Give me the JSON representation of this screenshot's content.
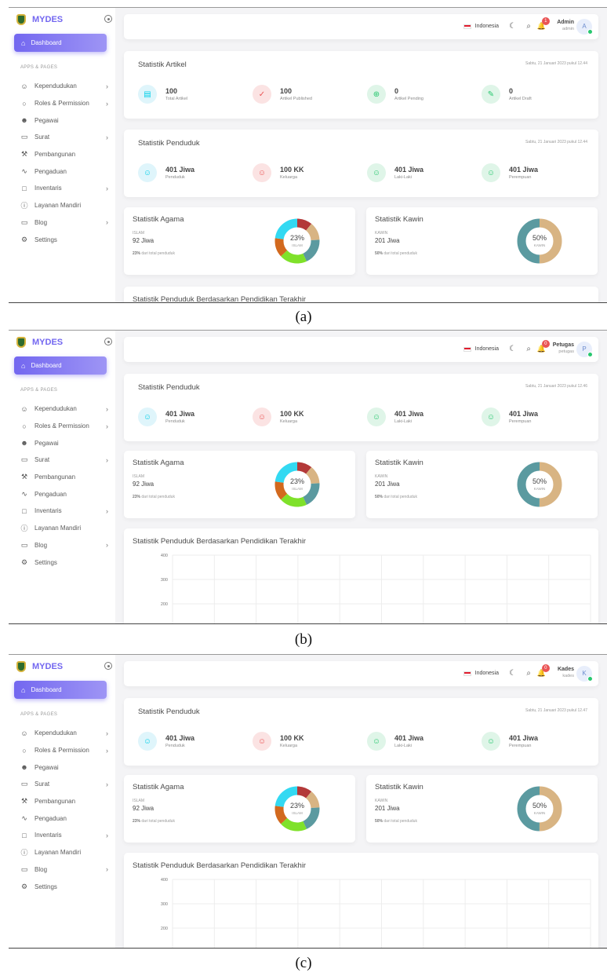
{
  "brand": {
    "name": "MYDES"
  },
  "sidebar": {
    "dashboard_label": "Dashboard",
    "section": "APPS & PAGES",
    "items": [
      {
        "label": "Kependudukan",
        "icon": "users-icon",
        "chevron": true
      },
      {
        "label": "Roles & Permission",
        "icon": "shield-icon",
        "chevron": true
      },
      {
        "label": "Pegawai",
        "icon": "user-check-icon",
        "chevron": false
      },
      {
        "label": "Surat",
        "icon": "inbox-icon",
        "chevron": true
      },
      {
        "label": "Pembangunan",
        "icon": "tool-icon",
        "chevron": false
      },
      {
        "label": "Pengaduan",
        "icon": "activity-icon",
        "chevron": false
      },
      {
        "label": "Inventaris",
        "icon": "tablet-icon",
        "chevron": true
      },
      {
        "label": "Layanan Mandiri",
        "icon": "info-icon",
        "chevron": false
      },
      {
        "label": "Blog",
        "icon": "monitor-icon",
        "chevron": true
      },
      {
        "label": "Settings",
        "icon": "settings-icon",
        "chevron": false
      }
    ]
  },
  "topbar": {
    "language": "Indonesia"
  },
  "captions": [
    "(a)",
    "(b)",
    "(c)"
  ],
  "panels": [
    {
      "user": {
        "name": "Admin",
        "role": "admin",
        "initial": "A",
        "notifications": "1"
      },
      "artikel": {
        "title": "Statistik Artikel",
        "date": "Sabtu, 21 Januari 2023 pukul 12.44",
        "stats": [
          {
            "value": "100",
            "label": "Total Artikel",
            "icon": "file-icon"
          },
          {
            "value": "100",
            "label": "Artikel Published",
            "icon": "check-icon"
          },
          {
            "value": "0",
            "label": "Artikel Pending",
            "icon": "plus-circle-icon"
          },
          {
            "value": "0",
            "label": "Artikel Draft",
            "icon": "edit-icon"
          }
        ]
      },
      "penduduk": {
        "title": "Statistik Penduduk",
        "date": "Sabtu, 21 Januari 2023 pukul 12.44"
      }
    },
    {
      "user": {
        "name": "Petugas",
        "role": "petugas",
        "initial": "P",
        "notifications": "0"
      },
      "penduduk": {
        "title": "Statistik Penduduk",
        "date": "Sabtu, 21 Januari 2023 pukul 12.46"
      }
    },
    {
      "user": {
        "name": "Kades",
        "role": "kades",
        "initial": "K",
        "notifications": "0"
      },
      "penduduk": {
        "title": "Statistik Penduduk",
        "date": "Sabtu, 21 Januari 2023 pukul 12.47"
      }
    }
  ],
  "penduduk_stats": [
    {
      "value": "401 Jiwa",
      "label": "Penduduk",
      "icon": "user-icon",
      "tone": "info"
    },
    {
      "value": "100 KK",
      "label": "Keluarga",
      "icon": "users-icon",
      "tone": "red"
    },
    {
      "value": "401 Jiwa",
      "label": "Laki-Laki",
      "icon": "user-icon",
      "tone": "green"
    },
    {
      "value": "401 Jiwa",
      "label": "Perempuan",
      "icon": "user-icon",
      "tone": "green"
    }
  ],
  "agama": {
    "title": "Statistik Agama",
    "label": "ISLAM",
    "value": "92 Jiwa",
    "pct_bold": "23%",
    "pct_text": "dari total penduduk",
    "center": "23%",
    "center_sub": "ISLAM",
    "segments": [
      {
        "share": 0.11,
        "color": "#b33939"
      },
      {
        "share": 0.13,
        "color": "#d8b483"
      },
      {
        "share": 0.19,
        "color": "#5b9aa0"
      },
      {
        "share": 0.2,
        "color": "#7fe12a"
      },
      {
        "share": 0.14,
        "color": "#d2691e"
      },
      {
        "share": 0.23,
        "color": "#33d9f2"
      }
    ]
  },
  "kawin": {
    "title": "Statistik Kawin",
    "label": "KAWIN",
    "value": "201 Jiwa",
    "pct_bold": "50%",
    "pct_text": "dari total penduduk",
    "center": "50%",
    "center_sub": "KAWIN",
    "segments": [
      {
        "share": 0.5,
        "color": "#d8b483"
      },
      {
        "share": 0.5,
        "color": "#5b9aa0"
      }
    ]
  },
  "pendidikan": {
    "title": "Statistik Penduduk Berdasarkan Pendidikan Terakhir",
    "y_ticks": [
      "400",
      "300",
      "200"
    ]
  }
}
